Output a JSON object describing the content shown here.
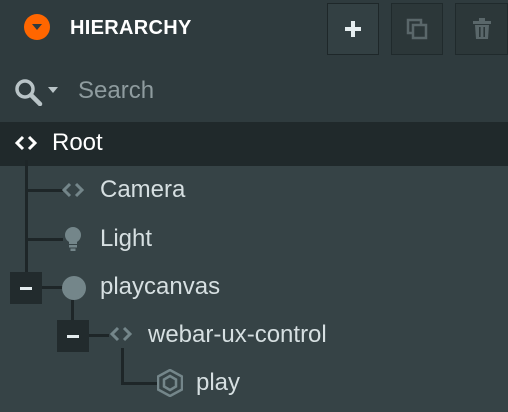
{
  "header": {
    "title": "HIERARCHY",
    "add_label": "+",
    "icons": [
      "chevron-down-icon",
      "plus-icon",
      "duplicate-icon",
      "trash-icon"
    ]
  },
  "search": {
    "placeholder": "Search",
    "value": ""
  },
  "tree": {
    "root": {
      "label": "Root",
      "icon": "entity-code-icon"
    },
    "camera": {
      "label": "Camera",
      "icon": "entity-code-icon"
    },
    "light": {
      "label": "Light",
      "icon": "lightbulb-icon"
    },
    "playcanvas": {
      "label": "playcanvas",
      "icon": "circle-icon",
      "expanded": true
    },
    "webar": {
      "label": "webar-ux-control",
      "icon": "entity-code-icon",
      "expanded": true
    },
    "play": {
      "label": "play",
      "icon": "hexagon-icon"
    }
  },
  "colors": {
    "accent": "#ff6600",
    "panel": "#364346",
    "header": "#2f3b3e",
    "selected_row": "#20292b"
  }
}
